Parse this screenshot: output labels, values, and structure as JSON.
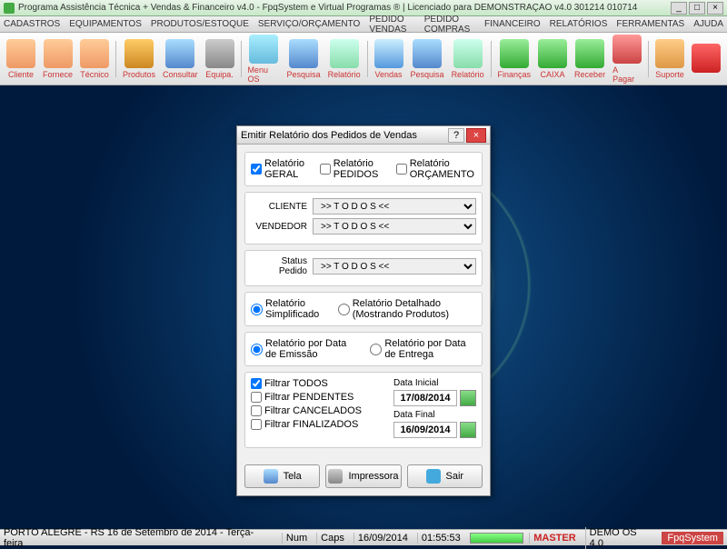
{
  "title": "Programa Assistência Técnica + Vendas & Financeiro v4.0 - FpqSystem e Virtual Programas ® | Licenciado para DEMONSTRAÇÃO v4.0 301214 010714",
  "menu": [
    "CADASTROS",
    "EQUIPAMENTOS",
    "PRODUTOS/ESTOQUE",
    "SERVIÇO/ORÇAMENTO",
    "PEDIDO VENDAS",
    "PEDIDO COMPRAS",
    "FINANCEIRO",
    "RELATÓRIOS",
    "FERRAMENTAS",
    "AJUDA"
  ],
  "toolbar": [
    {
      "label": "Cliente",
      "ico": "person"
    },
    {
      "label": "Fornece",
      "ico": "person"
    },
    {
      "label": "Técnico",
      "ico": "person"
    },
    {
      "sep": true
    },
    {
      "label": "Produtos",
      "ico": "box"
    },
    {
      "label": "Consultar",
      "ico": "search"
    },
    {
      "label": "Equipa.",
      "ico": "gear"
    },
    {
      "sep": true
    },
    {
      "label": "Menu OS",
      "ico": "menu"
    },
    {
      "label": "Pesquisa",
      "ico": "search"
    },
    {
      "label": "Relatório",
      "ico": "report"
    },
    {
      "sep": true
    },
    {
      "label": "Vendas",
      "ico": "screen"
    },
    {
      "label": "Pesquisa",
      "ico": "search"
    },
    {
      "label": "Relatório",
      "ico": "report"
    },
    {
      "sep": true
    },
    {
      "label": "Finanças",
      "ico": "money"
    },
    {
      "label": "CAIXA",
      "ico": "money"
    },
    {
      "label": "Receber",
      "ico": "money"
    },
    {
      "label": "A Pagar",
      "ico": "pay"
    },
    {
      "sep": true
    },
    {
      "label": "Suporte",
      "ico": "support"
    },
    {
      "label": "",
      "ico": "exit"
    }
  ],
  "dialog": {
    "title": "Emitir Relatório dos Pedidos de Vendas",
    "reports": {
      "geral": {
        "label": "Relatório GERAL",
        "checked": true
      },
      "pedidos": {
        "label": "Relatório PEDIDOS",
        "checked": false
      },
      "orcamento": {
        "label": "Relatório ORÇAMENTO",
        "checked": false
      }
    },
    "fields": {
      "cliente": {
        "label": "CLIENTE",
        "value": ">> T O D O S <<"
      },
      "vendedor": {
        "label": "VENDEDOR",
        "value": ">> T O D O S <<"
      },
      "status": {
        "label": "Status Pedido",
        "value": ">> T O D O S <<"
      }
    },
    "detail": {
      "simplificado": "Relatório Simplificado",
      "detalhado": "Relatório Detalhado (Mostrando Produtos)"
    },
    "databy": {
      "emissao": "Relatório por Data de Emissão",
      "entrega": "Relatório por Data de Entrega"
    },
    "filters": {
      "todos": {
        "label": "Filtrar TODOS",
        "checked": true
      },
      "pendentes": {
        "label": "Filtrar PENDENTES",
        "checked": false
      },
      "cancelados": {
        "label": "Filtrar CANCELADOS",
        "checked": false
      },
      "finalizados": {
        "label": "Filtrar FINALIZADOS",
        "checked": false
      }
    },
    "dates": {
      "inicial": {
        "label": "Data Inicial",
        "value": "17/08/2014"
      },
      "final": {
        "label": "Data Final",
        "value": "16/09/2014"
      }
    },
    "buttons": {
      "tela": "Tela",
      "impressora": "Impressora",
      "sair": "Sair"
    }
  },
  "status": {
    "location": "PORTO ALEGRE - RS 16 de Setembro de 2014 - Terça-feira",
    "num": "Num",
    "caps": "Caps",
    "date": "16/09/2014",
    "time": "01:55:53",
    "master": "MASTER",
    "demo": "DEMO OS 4.0",
    "brand": "FpqSystem"
  }
}
